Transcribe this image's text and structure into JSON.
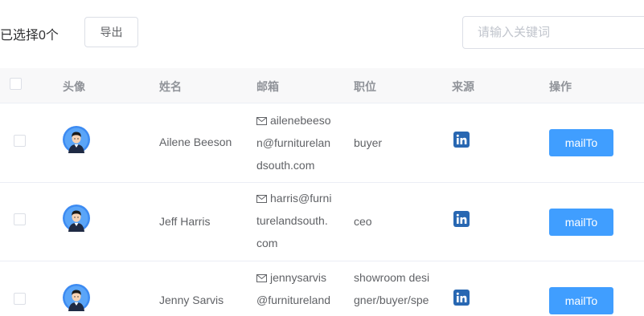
{
  "toolbar": {
    "selected_text": "已选择0个",
    "export_label": "导出",
    "search_placeholder": "请输入关键词"
  },
  "table": {
    "headers": {
      "avatar": "头像",
      "name": "姓名",
      "email": "邮箱",
      "position": "职位",
      "source": "来源",
      "action": "操作"
    },
    "rows": [
      {
        "name": "Ailene Beeson",
        "email_lines": [
          "ailenebeeso",
          "n@furniturelan",
          "dsouth.com"
        ],
        "position_lines": [
          "buyer"
        ],
        "action_label": "mailTo",
        "source_icon": "linkedin-icon"
      },
      {
        "name": "Jeff Harris",
        "email_lines": [
          "harris@furni",
          "turelandsouth.",
          "com"
        ],
        "position_lines": [
          "ceo"
        ],
        "action_label": "mailTo",
        "source_icon": "linkedin-icon"
      },
      {
        "name": "Jenny Sarvis",
        "email_lines": [
          "jennysarvis",
          "@furnitureland"
        ],
        "position_lines": [
          "showroom desi",
          "gner/buyer/spe"
        ],
        "action_label": "mailTo",
        "source_icon": "linkedin-icon"
      }
    ]
  },
  "colors": {
    "primary": "#409eff",
    "linkedin": "#2867b2",
    "header_bg": "#f8f8f9",
    "border": "#ebeef5"
  }
}
